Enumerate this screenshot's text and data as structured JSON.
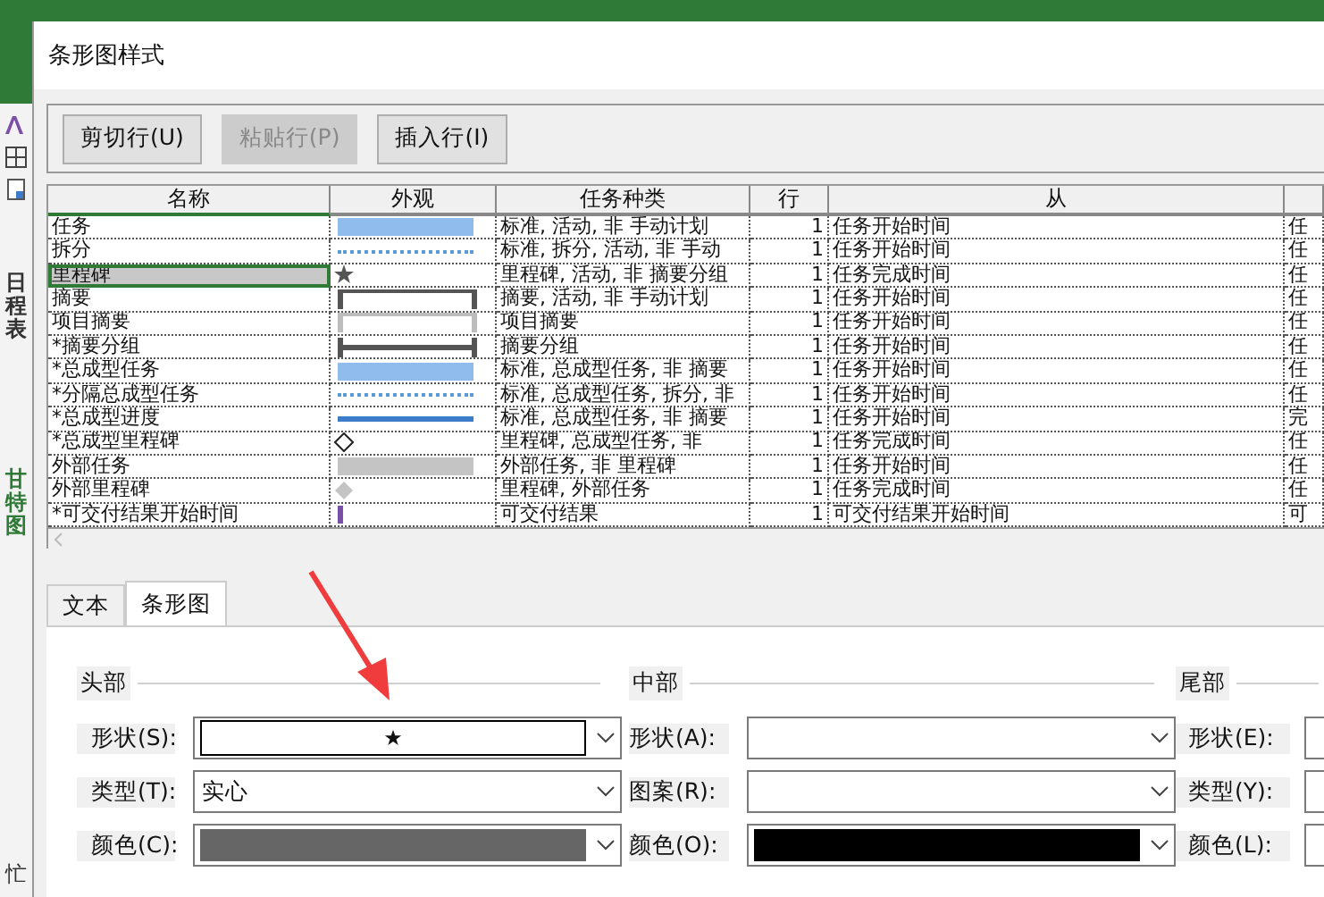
{
  "sidebar": {
    "schedule_label": "日程表",
    "gantt_label": "甘特图",
    "bottom_label": "忙"
  },
  "window": {
    "title": "条形图样式"
  },
  "toolbar": [
    {
      "label": "剪切行(U)",
      "disabled": false
    },
    {
      "label": "粘贴行(P)",
      "disabled": true
    },
    {
      "label": "插入行(I)",
      "disabled": false
    }
  ],
  "table": {
    "columns": [
      "名称",
      "外观",
      "任务种类",
      "行",
      "从"
    ],
    "rows": [
      {
        "name": "任务",
        "selected": false,
        "appearance": {
          "kind": "bar",
          "color": "#8fbcec"
        },
        "task_type": "标准, 活动, 非 手动计划",
        "row": "1",
        "from": "任务开始时间",
        "column_6": "任"
      },
      {
        "name": "拆分",
        "selected": false,
        "appearance": {
          "kind": "dotted",
          "color": "#5b9bd5"
        },
        "task_type": "标准, 拆分, 活动, 非 手动",
        "row": "1",
        "from": "任务开始时间",
        "column_6": "任"
      },
      {
        "name": "里程碑",
        "selected": true,
        "appearance": {
          "kind": "star",
          "color": "#555555"
        },
        "task_type": "里程碑, 活动, 非 摘要分组",
        "row": "1",
        "from": "任务完成时间",
        "column_6": "任"
      },
      {
        "name": "摘要",
        "selected": false,
        "appearance": {
          "kind": "summary",
          "color": "#555555"
        },
        "task_type": "摘要, 活动, 非 手动计划",
        "row": "1",
        "from": "任务开始时间",
        "column_6": "任"
      },
      {
        "name": "项目摘要",
        "selected": false,
        "appearance": {
          "kind": "summary",
          "color": "#bdbdbd"
        },
        "task_type": "项目摘要",
        "row": "1",
        "from": "任务开始时间",
        "column_6": "任"
      },
      {
        "name": "*摘要分组",
        "selected": false,
        "appearance": {
          "kind": "group",
          "color": "#555555"
        },
        "task_type": "摘要分组",
        "row": "1",
        "from": "任务开始时间",
        "column_6": "任"
      },
      {
        "name": "*总成型任务",
        "selected": false,
        "appearance": {
          "kind": "bar",
          "color": "#8fbcec"
        },
        "task_type": "标准, 总成型任务, 非 摘要",
        "row": "1",
        "from": "任务开始时间",
        "column_6": "任"
      },
      {
        "name": "*分隔总成型任务",
        "selected": false,
        "appearance": {
          "kind": "dotted",
          "color": "#5b9bd5"
        },
        "task_type": "标准, 总成型任务, 拆分, 非",
        "row": "1",
        "from": "任务开始时间",
        "column_6": "任"
      },
      {
        "name": "*总成型进度",
        "selected": false,
        "appearance": {
          "kind": "line",
          "color": "#3d7cc9"
        },
        "task_type": "标准, 总成型任务, 非 摘要",
        "row": "1",
        "from": "任务开始时间",
        "column_6": "完"
      },
      {
        "name": "*总成型里程碑",
        "selected": false,
        "appearance": {
          "kind": "diamond-outline",
          "color": "#222222"
        },
        "task_type": "里程碑, 总成型任务, 非",
        "row": "1",
        "from": "任务完成时间",
        "column_6": "任"
      },
      {
        "name": "外部任务",
        "selected": false,
        "appearance": {
          "kind": "bar",
          "color": "#c4c4c4"
        },
        "task_type": "外部任务, 非 里程碑",
        "row": "1",
        "from": "任务开始时间",
        "column_6": "任"
      },
      {
        "name": "外部里程碑",
        "selected": false,
        "appearance": {
          "kind": "diamond",
          "color": "#c4c4c4"
        },
        "task_type": "里程碑, 外部任务",
        "row": "1",
        "from": "任务完成时间",
        "column_6": "任"
      },
      {
        "name": "*可交付结果开始时间",
        "selected": false,
        "appearance": {
          "kind": "tick",
          "color": "#7b4fa8"
        },
        "task_type": "可交付结果",
        "row": "1",
        "from": "可交付结果开始时间",
        "column_6": "可"
      }
    ]
  },
  "tabs": [
    {
      "label": "文本",
      "selected": false
    },
    {
      "label": "条形图",
      "selected": true
    }
  ],
  "groups": [
    {
      "title": "头部",
      "fields": [
        {
          "label": "形状(S):",
          "kind": "symbol",
          "symbol": "★"
        },
        {
          "label": "类型(T):",
          "kind": "text",
          "value": "实心"
        },
        {
          "label": "颜色(C):",
          "kind": "color",
          "color": "#666666"
        }
      ]
    },
    {
      "title": "中部",
      "fields": [
        {
          "label": "形状(A):",
          "kind": "text"
        },
        {
          "label": "图案(R):",
          "kind": "text"
        },
        {
          "label": "颜色(O):",
          "kind": "color",
          "color": "#000000"
        }
      ]
    },
    {
      "title": "尾部",
      "fields": [
        {
          "label": "形状(E):",
          "kind": "stub"
        },
        {
          "label": "类型(Y):",
          "kind": "stub"
        },
        {
          "label": "颜色(L):",
          "kind": "stub"
        }
      ]
    }
  ]
}
